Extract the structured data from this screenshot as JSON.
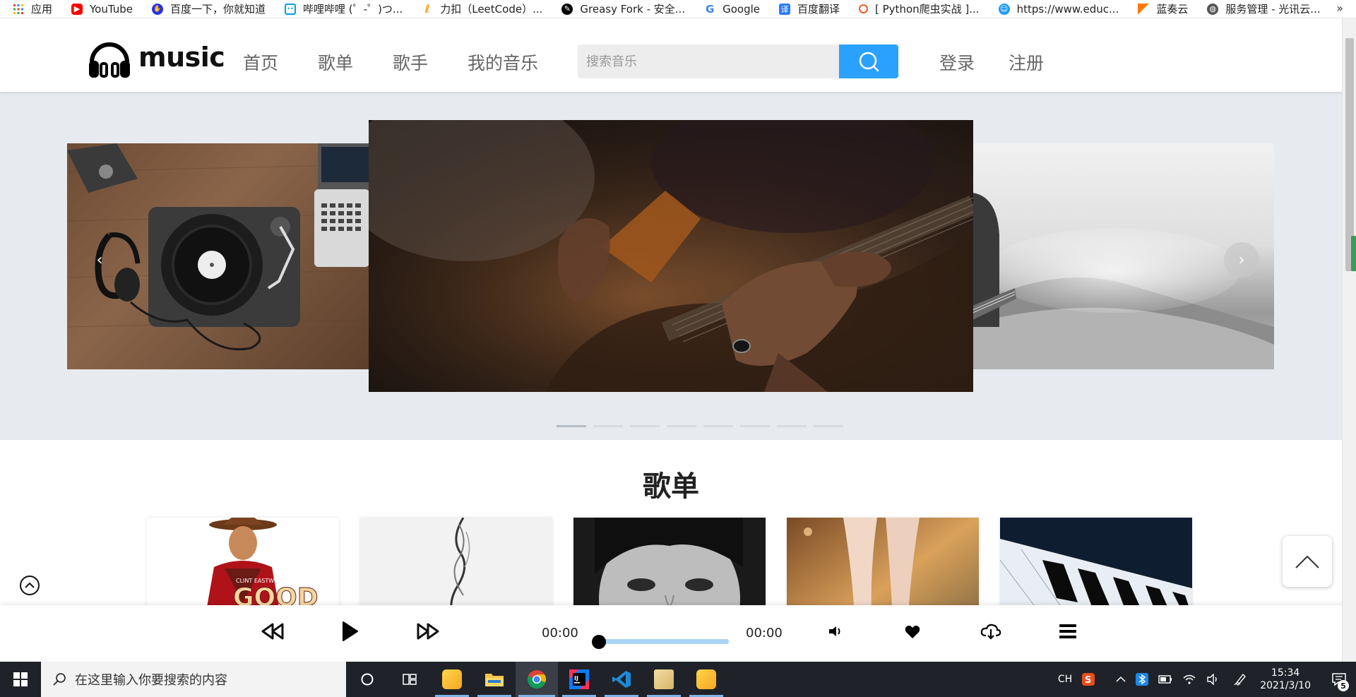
{
  "bookmarks": {
    "items": [
      {
        "label": "应用",
        "icon": "apps-grid-icon"
      },
      {
        "label": "YouTube",
        "icon": "youtube-icon"
      },
      {
        "label": "百度一下，你就知道",
        "icon": "baidu-icon"
      },
      {
        "label": "哔哩哔哩 (゜-゜)つ...",
        "icon": "bilibili-icon"
      },
      {
        "label": "力扣（LeetCode）...",
        "icon": "leetcode-icon"
      },
      {
        "label": "Greasy Fork - 安全...",
        "icon": "greasyfork-icon"
      },
      {
        "label": "Google",
        "icon": "google-icon"
      },
      {
        "label": "百度翻译",
        "icon": "baidu-translate-icon"
      },
      {
        "label": "[ Python爬虫实战 ]...",
        "icon": "python-crawler-icon"
      },
      {
        "label": "https://www.educ...",
        "icon": "educoder-icon"
      },
      {
        "label": "蓝奏云",
        "icon": "lanzou-icon"
      },
      {
        "label": "服务管理 - 光讯云...",
        "icon": "globe-icon"
      }
    ],
    "more": "»"
  },
  "header": {
    "logo_text": "music",
    "nav": [
      "首页",
      "歌单",
      "歌手",
      "我的音乐"
    ],
    "search_placeholder": "搜索音乐",
    "login": "登录",
    "register": "注册"
  },
  "banner": {
    "arrow_left": "‹",
    "arrow_right": "›",
    "slide_count": 8,
    "active_slide": 1
  },
  "playlists": {
    "title": "歌单",
    "cards": [
      {
        "name": "playlist-card-good"
      },
      {
        "name": "playlist-card-smoke"
      },
      {
        "name": "playlist-card-portrait"
      },
      {
        "name": "playlist-card-legs"
      },
      {
        "name": "playlist-card-piano"
      }
    ]
  },
  "player": {
    "current_time": "00:00",
    "total_time": "00:00",
    "progress": 0
  },
  "taskbar": {
    "search_placeholder": "在这里输入你要搜索的内容",
    "ime": "CH",
    "time": "15:34",
    "date": "2021/3/10",
    "notifications": "5"
  },
  "colors": {
    "accent": "#2aa1ff",
    "banner_bg": "#e7ebef",
    "progress": "#a9d4f5",
    "taskbar": "#1f2228"
  }
}
